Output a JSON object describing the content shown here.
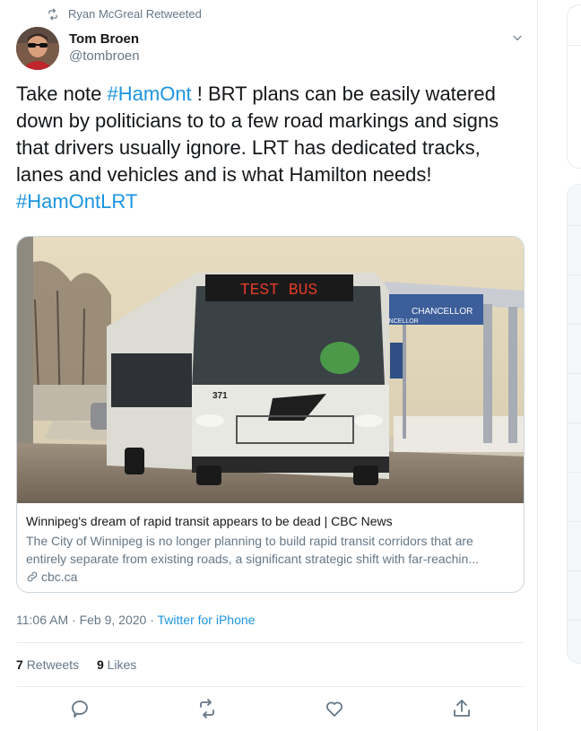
{
  "retweet_context": {
    "text": "Ryan McGreal Retweeted",
    "icon": "retweet-icon"
  },
  "author": {
    "name": "Tom Broen",
    "handle": "@tombroen"
  },
  "tweet": {
    "segments": [
      {
        "text": "Take note ",
        "type": "text"
      },
      {
        "text": "#HamOnt",
        "type": "hashtag"
      },
      {
        "text": " ! BRT plans can be easily watered down by politicians to to a few road markings and signs that drivers usually ignore. LRT has dedicated tracks, lanes and vehicles and is what Hamilton needs! ",
        "type": "text"
      },
      {
        "text": "#HamOntLRT",
        "type": "hashtag"
      }
    ]
  },
  "card": {
    "image": {
      "bus_sign": "TEST BUS",
      "bus_number": "371",
      "station_sign": "CHANCELLOR",
      "station_sign_sub": "ANCELLOR"
    },
    "title": "Winnipeg's dream of rapid transit appears to be dead | CBC News",
    "description": "The City of Winnipeg is no longer planning to build rapid transit corridors that are entirely separate from existing roads, a significant strategic shift with far-reachin...",
    "domain": "cbc.ca"
  },
  "meta": {
    "time": "11:06 AM",
    "date": "Feb 9, 2020",
    "sep": "·",
    "source": "Twitter for iPhone"
  },
  "stats": {
    "retweets_count": "7",
    "retweets_label": "Retweets",
    "likes_count": "9",
    "likes_label": "Likes"
  },
  "colors": {
    "link": "#1b95e0",
    "secondary": "#657786",
    "border": "#e6ecf0"
  },
  "actions": [
    "reply-icon",
    "retweet-icon",
    "like-icon",
    "share-icon"
  ]
}
